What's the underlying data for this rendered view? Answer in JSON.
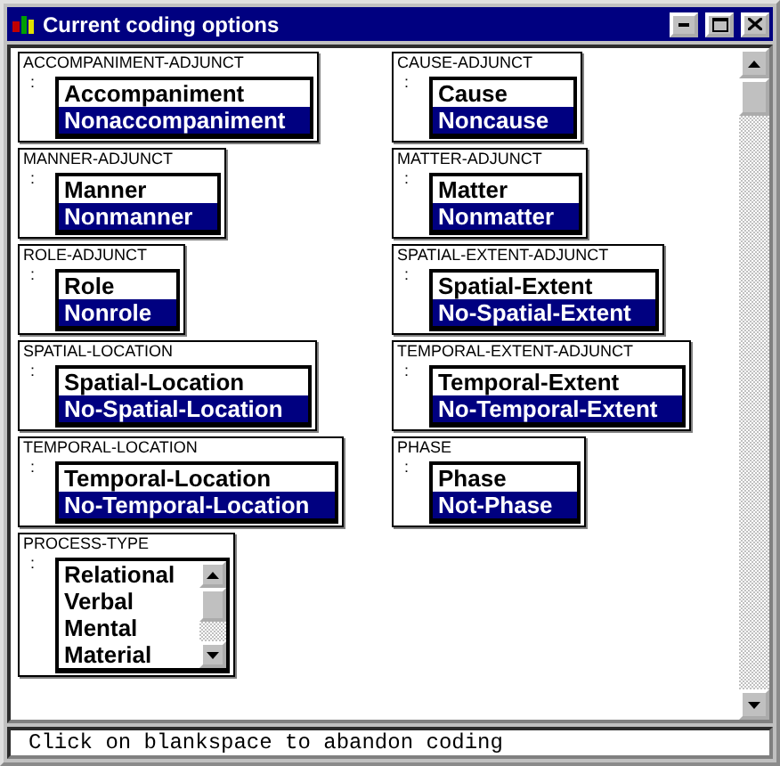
{
  "window": {
    "title": "Current coding options"
  },
  "groups": [
    {
      "name": "ACCOMPANIMENT-ADJUNCT",
      "kind": "list",
      "options": [
        {
          "label": "Accompaniment",
          "selected": false
        },
        {
          "label": "Nonaccompaniment",
          "selected": true
        }
      ]
    },
    {
      "name": "CAUSE-ADJUNCT",
      "kind": "list",
      "options": [
        {
          "label": "Cause",
          "selected": false
        },
        {
          "label": "Noncause",
          "selected": true
        }
      ]
    },
    {
      "name": "MANNER-ADJUNCT",
      "kind": "list",
      "options": [
        {
          "label": "Manner",
          "selected": false
        },
        {
          "label": "Nonmanner",
          "selected": true
        }
      ]
    },
    {
      "name": "MATTER-ADJUNCT",
      "kind": "list",
      "options": [
        {
          "label": "Matter",
          "selected": false
        },
        {
          "label": "Nonmatter",
          "selected": true
        }
      ]
    },
    {
      "name": "ROLE-ADJUNCT",
      "kind": "list",
      "options": [
        {
          "label": "Role",
          "selected": false
        },
        {
          "label": "Nonrole",
          "selected": true
        }
      ]
    },
    {
      "name": "SPATIAL-EXTENT-ADJUNCT",
      "kind": "list",
      "options": [
        {
          "label": "Spatial-Extent",
          "selected": false
        },
        {
          "label": "No-Spatial-Extent",
          "selected": true
        }
      ]
    },
    {
      "name": "SPATIAL-LOCATION",
      "kind": "list",
      "options": [
        {
          "label": "Spatial-Location",
          "selected": false
        },
        {
          "label": "No-Spatial-Location",
          "selected": true
        }
      ]
    },
    {
      "name": "TEMPORAL-EXTENT-ADJUNCT",
      "kind": "list",
      "options": [
        {
          "label": "Temporal-Extent",
          "selected": false
        },
        {
          "label": "No-Temporal-Extent",
          "selected": true
        }
      ]
    },
    {
      "name": "TEMPORAL-LOCATION",
      "kind": "list",
      "options": [
        {
          "label": "Temporal-Location",
          "selected": false
        },
        {
          "label": "No-Temporal-Location",
          "selected": true
        }
      ]
    },
    {
      "name": "PHASE",
      "kind": "list",
      "options": [
        {
          "label": "Phase",
          "selected": false
        },
        {
          "label": "Not-Phase",
          "selected": true
        }
      ]
    },
    {
      "name": "PROCESS-TYPE",
      "kind": "scroll",
      "options": [
        {
          "label": "Relational",
          "selected": false
        },
        {
          "label": "Verbal",
          "selected": false
        },
        {
          "label": "Mental",
          "selected": false
        },
        {
          "label": "Material",
          "selected": false
        }
      ]
    }
  ],
  "separator": ":",
  "status_bar": {
    "text": "Click on blankspace to abandon coding"
  }
}
